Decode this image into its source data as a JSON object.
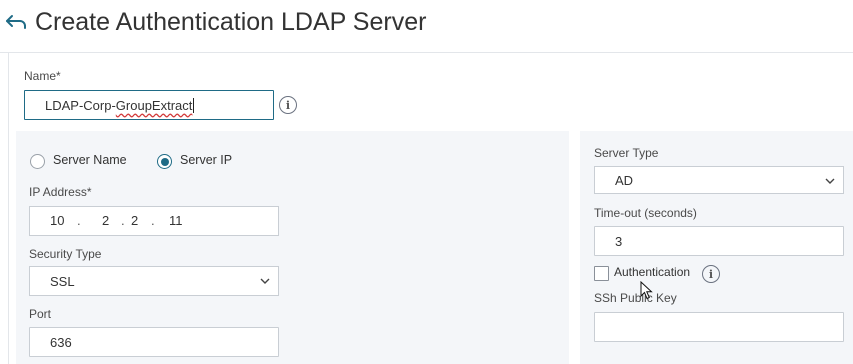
{
  "header": {
    "title": "Create Authentication LDAP Server",
    "back_icon": "back-arrow-icon"
  },
  "form": {
    "name_label": "Name*",
    "name_value_prefix": "LDAP-Corp-",
    "name_value_misspelled": "GroupExtract",
    "name_info_icon": "info-icon",
    "server_mode": {
      "options": [
        "Server Name",
        "Server IP"
      ],
      "selected": "Server IP"
    },
    "ip_label": "IP Address*",
    "ip_octets": [
      "10",
      "2",
      "2",
      "11"
    ],
    "security_type_label": "Security Type",
    "security_type_value": "SSL",
    "port_label": "Port",
    "port_value": "636",
    "server_type_label": "Server Type",
    "server_type_value": "AD",
    "timeout_label": "Time-out (seconds)",
    "timeout_value": "3",
    "authentication_label": "Authentication",
    "authentication_checked": false,
    "ssh_key_label": "SSh Public Key",
    "ssh_key_value": ""
  },
  "colors": {
    "accent": "#1f6b86",
    "panel_bg": "#f4f6f9",
    "border": "#c9ced4"
  }
}
